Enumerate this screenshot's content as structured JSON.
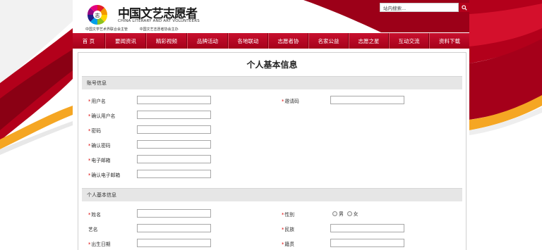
{
  "header": {
    "logo_title": "中国文艺志愿者",
    "logo_subtitle": "CHINA LITERARY AND ART VOLUNTEERS",
    "hosted_by": [
      "中国文学艺术界联合会主管",
      "中国文艺志愿者协会主办"
    ],
    "search_placeholder": "站内搜索...",
    "accent_color": "#b3001b"
  },
  "nav": {
    "items": [
      "首 页",
      "要闻资讯",
      "精彩视频",
      "品牌活动",
      "各地联动",
      "志愿者协",
      "名家公益",
      "志愿之星",
      "互动交流",
      "资料下载"
    ]
  },
  "form": {
    "title": "个人基本信息",
    "account_section": {
      "title": "账号信息",
      "left_fields": [
        "用户名",
        "确认用户名",
        "密码",
        "确认密码",
        "电子邮箱",
        "确认电子邮箱"
      ],
      "right_fields": [
        "邀请码"
      ]
    },
    "personal_section": {
      "title": "个人基本信息",
      "rows": [
        {
          "left": "姓名",
          "left_required": true,
          "right": "性别",
          "right_required": true
        },
        {
          "left": "艺名",
          "left_required": false,
          "right": "民族",
          "right_required": true
        },
        {
          "left": "出生日期",
          "left_required": true,
          "right": "籍贯",
          "right_required": true
        }
      ],
      "gender_options": [
        "男",
        "女"
      ]
    }
  }
}
